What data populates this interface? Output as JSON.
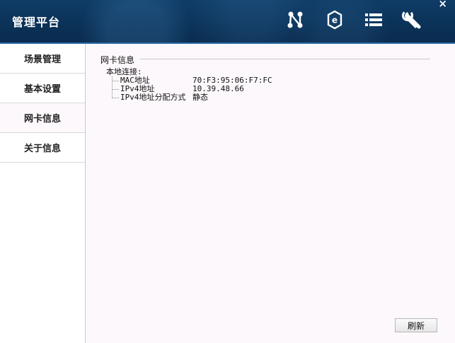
{
  "app": {
    "title": "管理平台",
    "close_glyph": "×"
  },
  "header_icons": [
    "topology-icon",
    "ie-browser-icon",
    "list-icon",
    "wrench-icon"
  ],
  "sidebar": {
    "items": [
      {
        "label": "场景管理"
      },
      {
        "label": "基本设置"
      },
      {
        "label": "网卡信息",
        "active": true
      },
      {
        "label": "关于信息"
      }
    ]
  },
  "main": {
    "group_title": "网卡信息",
    "tree_root": "本地连接:",
    "rows": [
      {
        "key": "MAC地址",
        "value": "70:F3:95:06:F7:FC"
      },
      {
        "key": "IPv4地址",
        "value": "10.39.48.66"
      },
      {
        "key": "IPv4地址分配方式",
        "value": "静态"
      }
    ],
    "refresh_label": "刷新"
  },
  "colors": {
    "header": "#0b3258",
    "content_bg": "#fdf8fb",
    "accent": "#2a6aa5"
  }
}
